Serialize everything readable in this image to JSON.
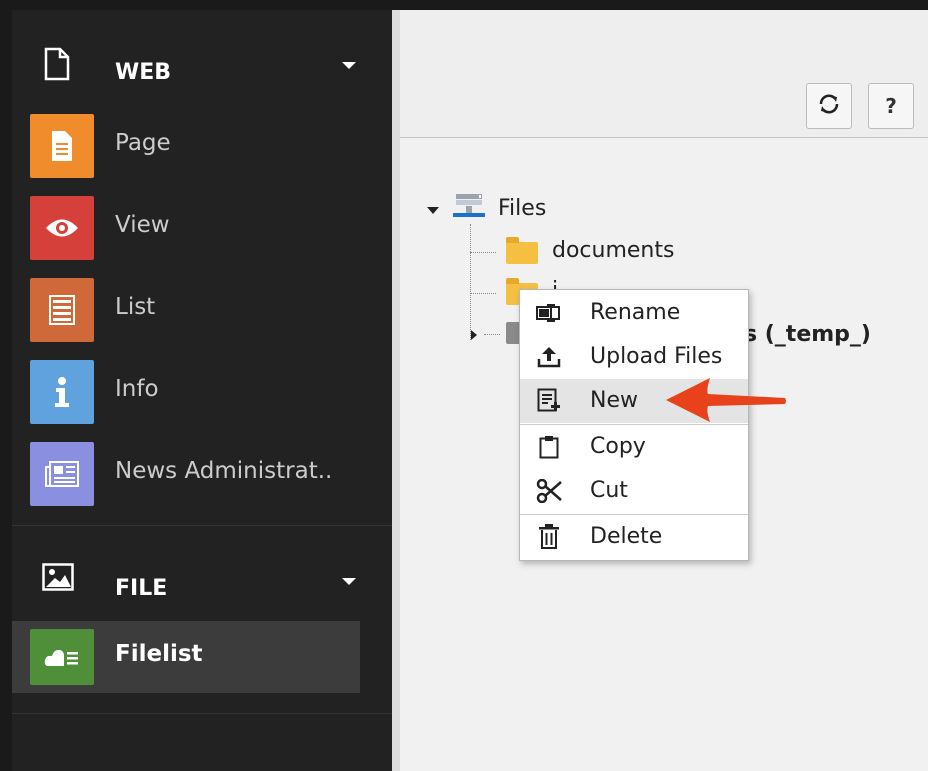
{
  "module_menu": {
    "groups": [
      {
        "label": "WEB",
        "icon": "page-outline-icon"
      },
      {
        "label": "FILE",
        "icon": "image-icon"
      }
    ],
    "web_items": [
      {
        "label": "Page",
        "icon": "page-icon",
        "color": "#f08c2c"
      },
      {
        "label": "View",
        "icon": "eye-icon",
        "color": "#d6403b"
      },
      {
        "label": "List",
        "icon": "list-icon",
        "color": "#d0693a"
      },
      {
        "label": "Info",
        "icon": "info-icon",
        "color": "#5fa2dd"
      },
      {
        "label": "News Administrat..",
        "icon": "news-icon",
        "color": "#8b8fe0"
      }
    ],
    "file_items": [
      {
        "label": "Filelist",
        "icon": "cloud-list-icon",
        "color": "#4f8f3a",
        "active": true
      }
    ]
  },
  "docheader": {
    "refresh_icon": "refresh-icon",
    "help_label": "?"
  },
  "tree": {
    "root": {
      "label": "Files",
      "icon": "storage-icon"
    },
    "children": [
      {
        "label": "documents",
        "icon": "folder-icon"
      },
      {
        "label": "i",
        "icon": "folder-icon"
      },
      {
        "label": "s (_temp_)",
        "icon": "folder-icon"
      }
    ]
  },
  "context_menu": {
    "items": [
      {
        "label": "Rename",
        "icon": "rename-icon"
      },
      {
        "label": "Upload Files",
        "icon": "upload-icon"
      },
      {
        "label": "New",
        "icon": "new-file-icon",
        "hover": true
      },
      {
        "label": "Copy",
        "icon": "clipboard-icon"
      },
      {
        "label": "Cut",
        "icon": "scissors-icon"
      },
      {
        "label": "Delete",
        "icon": "trash-icon"
      }
    ]
  },
  "annotation": {
    "arrow_color": "#e8421c"
  }
}
